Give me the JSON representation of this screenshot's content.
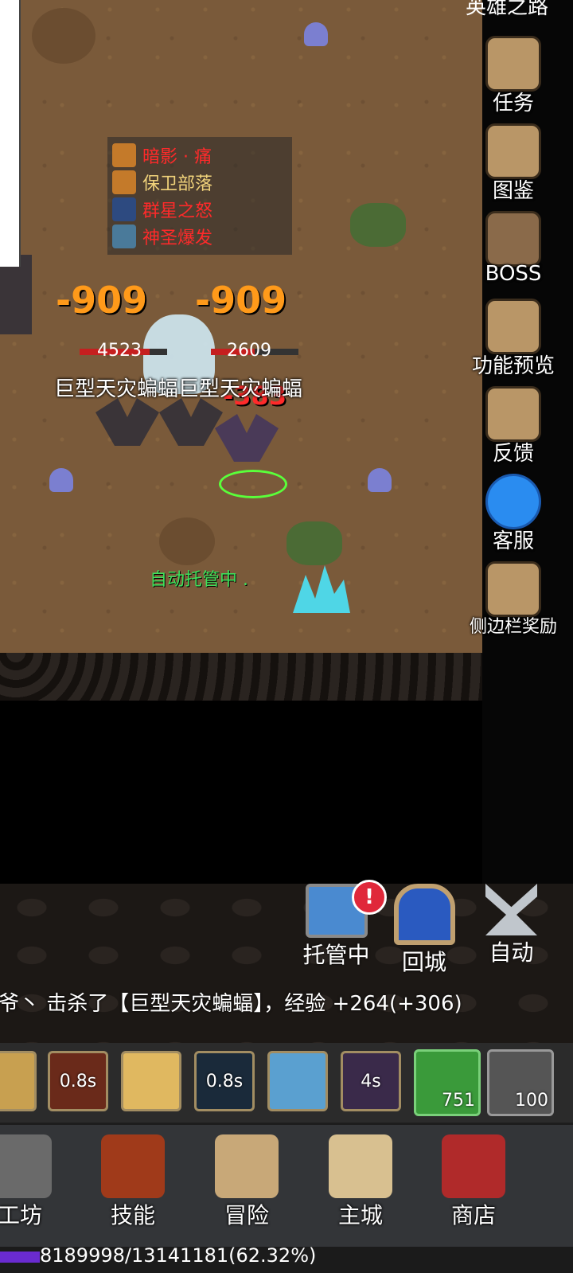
{
  "right_menu": {
    "top_label": "英雄之路",
    "items": [
      {
        "label": "任务",
        "icon": "quest-scroll-icon"
      },
      {
        "label": "图鉴",
        "icon": "codex-book-icon"
      },
      {
        "label": "BOSS",
        "icon": "boss-skull-icon"
      },
      {
        "label": "功能预览",
        "icon": "preview-scroll-icon"
      },
      {
        "label": "反馈",
        "icon": "feedback-envelope-icon"
      },
      {
        "label": "客服",
        "icon": "support-chat-icon"
      },
      {
        "label": "侧边栏奖励",
        "icon": "reward-bag-icon"
      }
    ]
  },
  "buffs": [
    {
      "label": "暗影 · 痛",
      "color": "#ff2a2a"
    },
    {
      "label": "保卫部落",
      "color": "#f0d27a"
    },
    {
      "label": "群星之怒",
      "color": "#ff2a2a"
    },
    {
      "label": "神圣爆发",
      "color": "#ff2a2a"
    }
  ],
  "combat": {
    "damage_left": "-909",
    "damage_right": "-909",
    "damage_small": "-383",
    "mob_hp_left": "4523",
    "mob_hp_right": "2609",
    "mob_name": "巨型天灾蝙蝠巨型天灾蝙蝠",
    "auto_status": "自动托管中 ."
  },
  "controls": {
    "host_label": "托管中",
    "return_label": "回城",
    "auto_label": "自动",
    "host_alert": "!"
  },
  "log": "爷丶 击杀了【巨型天灾蝙蝠】，经验 +264(+306)",
  "skills": [
    {
      "cooldown": ""
    },
    {
      "cooldown": "0.8s"
    },
    {
      "cooldown": ""
    },
    {
      "cooldown": "0.8s"
    },
    {
      "cooldown": ""
    },
    {
      "cooldown": "4s"
    }
  ],
  "items": [
    {
      "count": "751",
      "icon": "carrot-food-icon",
      "color": "#3a9a3a"
    },
    {
      "count": "100",
      "icon": "potion-icon",
      "color": "#555555"
    }
  ],
  "nav": [
    {
      "label": "工坊",
      "icon": "workshop-icon"
    },
    {
      "label": "技能",
      "icon": "skill-book-icon"
    },
    {
      "label": "冒险",
      "icon": "adventure-map-icon"
    },
    {
      "label": "主城",
      "icon": "castle-icon"
    },
    {
      "label": "商店",
      "icon": "shop-icon"
    }
  ],
  "xp": {
    "text": "8189998/13141181(62.32%)",
    "fraction": 0.6232
  }
}
